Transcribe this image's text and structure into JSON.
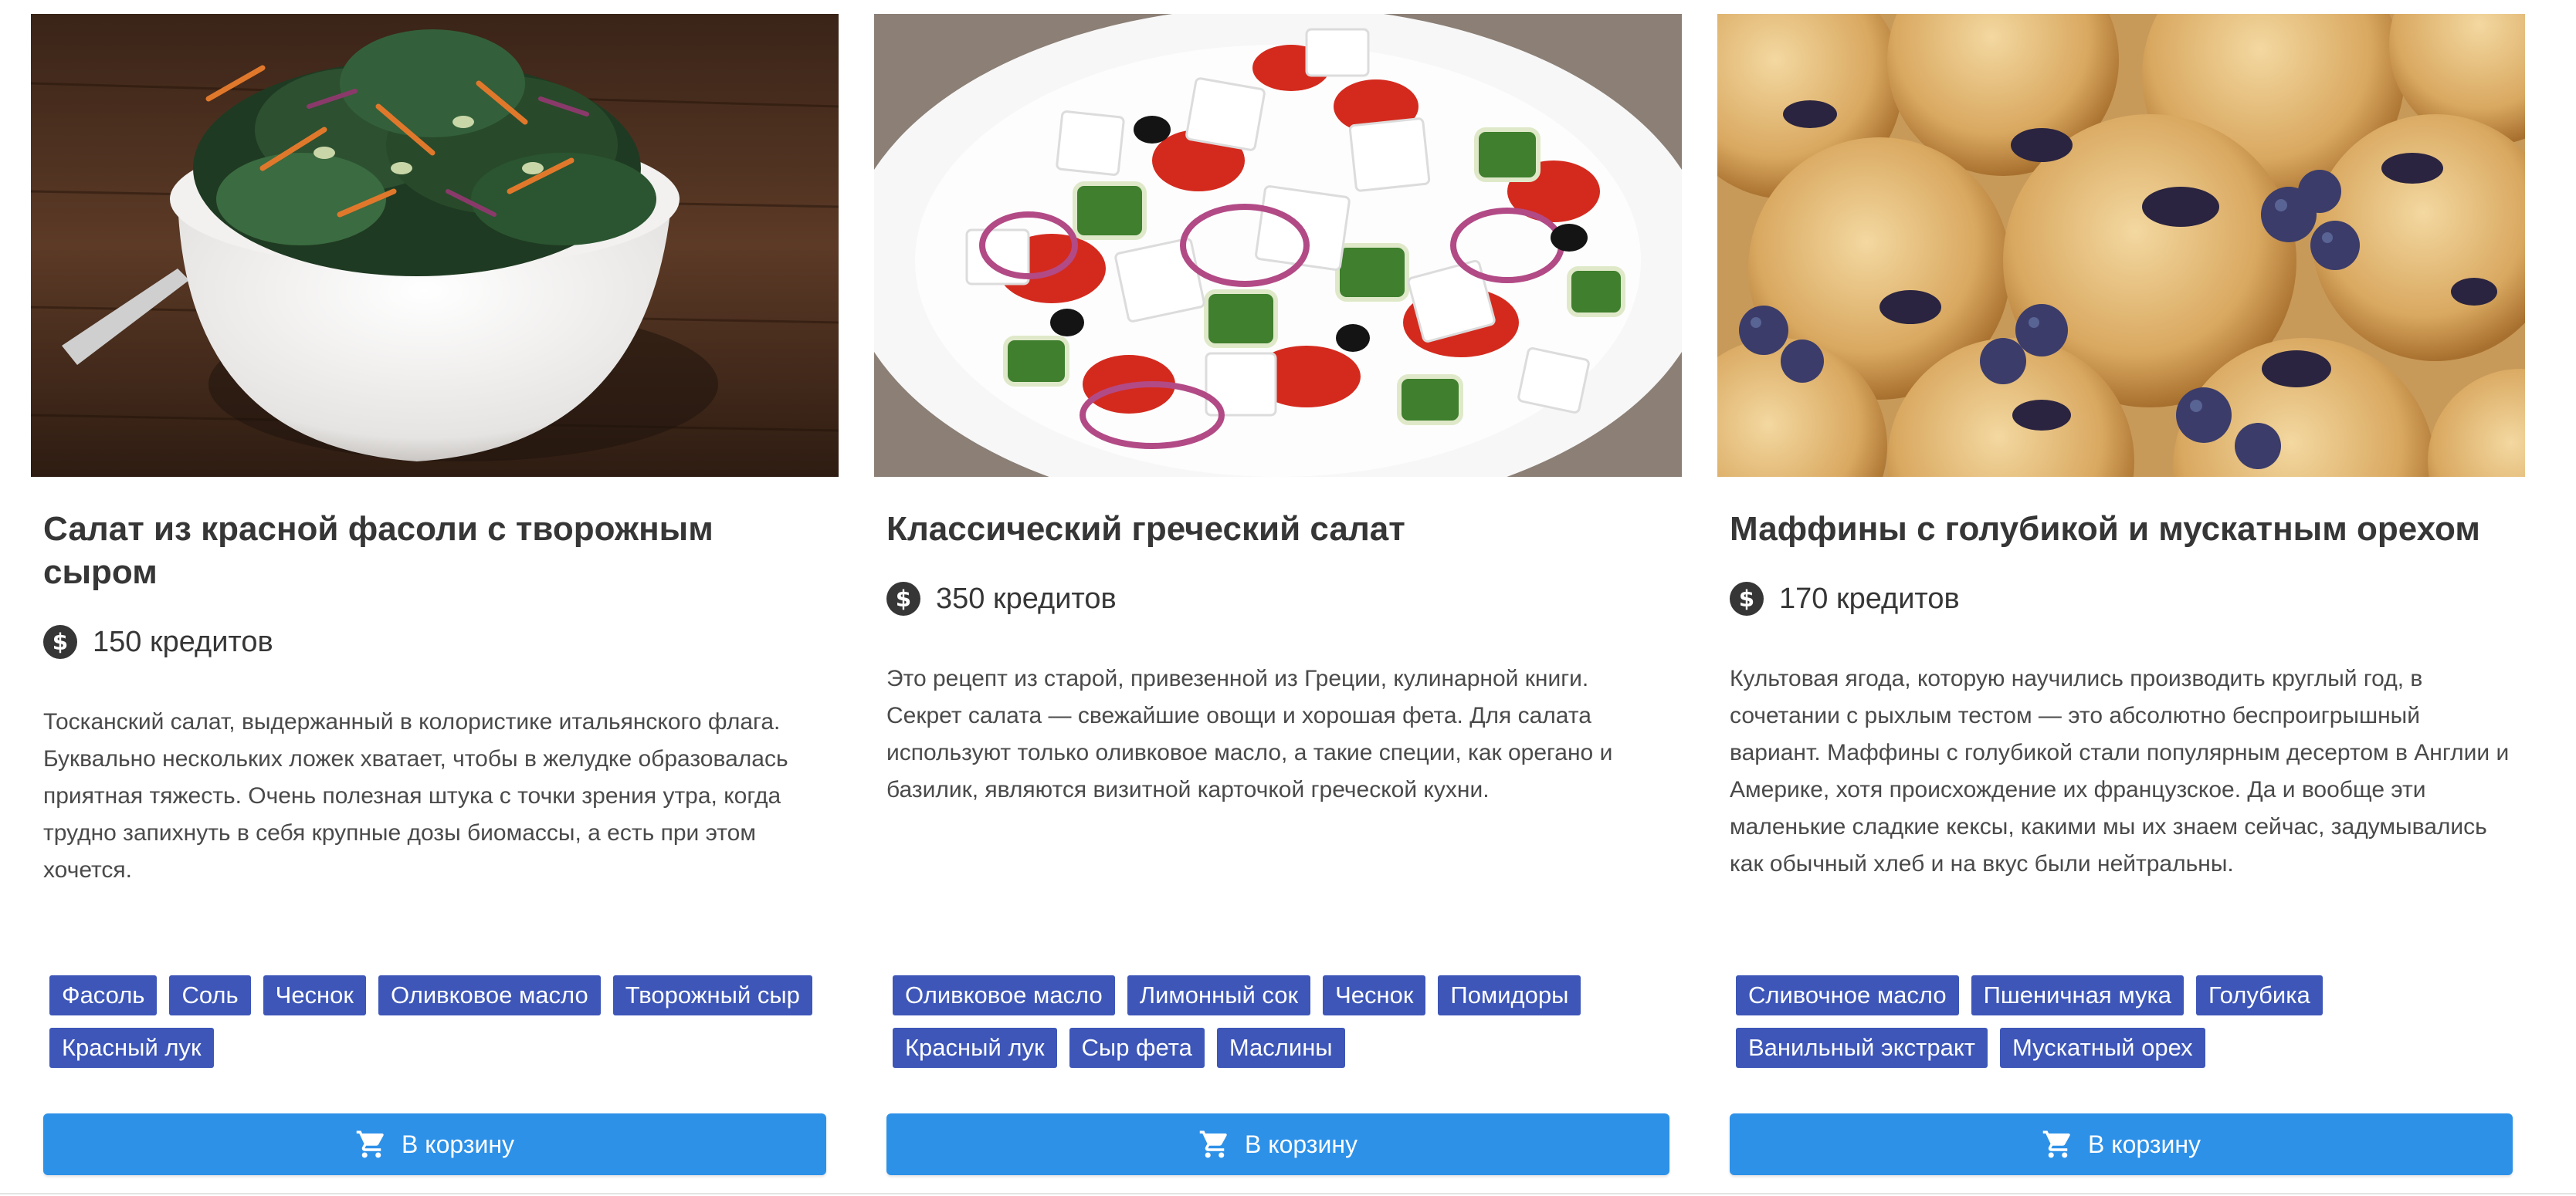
{
  "cards": [
    {
      "image_alt": "kale salad in white bowl",
      "title": "Салат из красной фасоли с творожным сыром",
      "price": "150 кредитов",
      "description": "Тосканский салат, выдержанный в колористике итальянского флага. Буквально нескольких ложек хватает, чтобы в желудке образовалась приятная тяжесть. Очень полезная штука с точки зрения утра, когда трудно запихнуть в себя крупные дозы биомассы, а есть при этом хочется.",
      "tags": [
        "Фасоль",
        "Соль",
        "Чеснок",
        "Оливковое масло",
        "Творожный сыр",
        "Красный лук"
      ],
      "button_label": "В корзину"
    },
    {
      "image_alt": "greek salad with feta cubes",
      "title": "Классический греческий салат",
      "price": "350 кредитов",
      "description": "Это рецепт из старой, привезенной из Греции, кулинарной книги. Секрет салата — свежайшие овощи и хорошая фета. Для салата используют только оливковое масло, а такие специи, как орегано и базилик, являются визитной карточкой греческой кухни.",
      "tags": [
        "Оливковое масло",
        "Лимонный сок",
        "Чеснок",
        "Помидоры",
        "Красный лук",
        "Сыр фета",
        "Маслины"
      ],
      "button_label": "В корзину"
    },
    {
      "image_alt": "blueberry muffins",
      "title": "Маффины с голубикой и мускатным орехом",
      "price": "170 кредитов",
      "description": "Культовая ягода, которую научились производить круглый год, в сочетании с рыхлым тестом — это абсолютно беспроигрышный вариант. Маффины с голубикой стали популярным десертом в Англии и Америке, хотя происхождение их французское. Да и вообще эти маленькие сладкие кексы, какими мы их знаем сейчас, задумывались как обычный хлеб и на вкус были нейтральны.",
      "tags": [
        "Сливочное масло",
        "Пшеничная мука",
        "Голубика",
        "Ванильный экстракт",
        "Мускатный орех"
      ],
      "button_label": "В корзину"
    }
  ],
  "icons": {
    "price": "dollar-coin-icon",
    "cart": "shopping-cart-icon"
  },
  "colors": {
    "tag_bg": "#3d56b8",
    "button_bg": "#2d91e8",
    "title": "#363636"
  }
}
